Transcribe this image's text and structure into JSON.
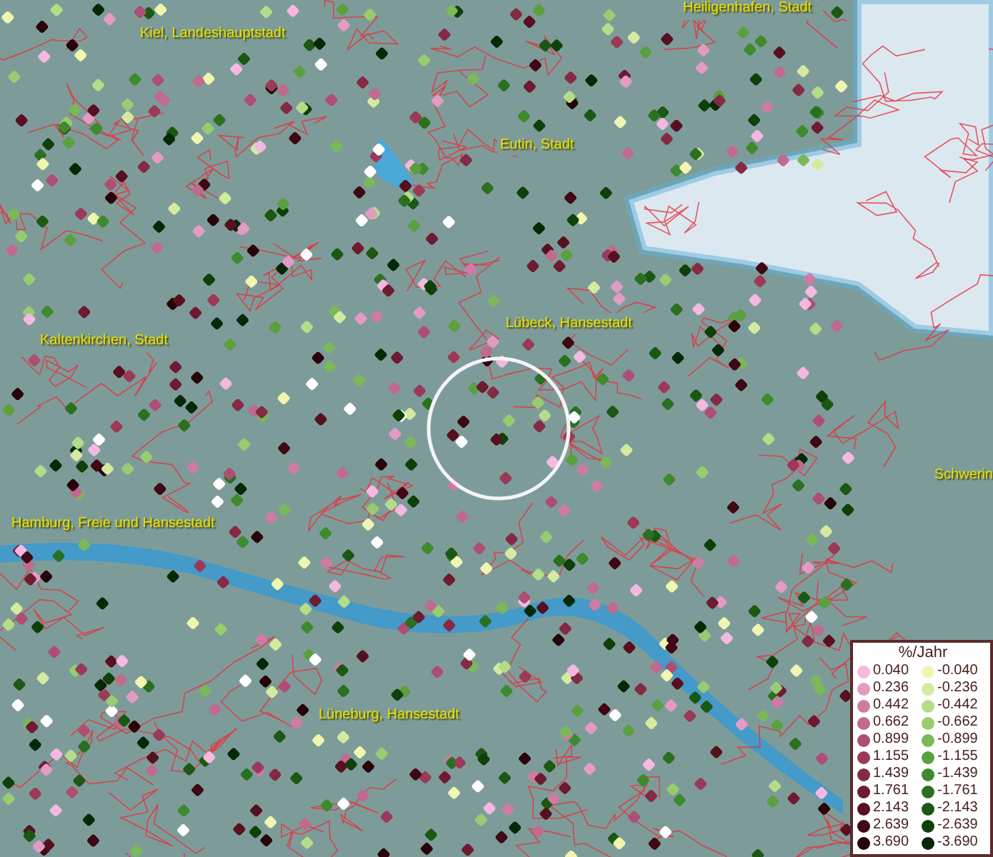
{
  "map": {
    "places": [
      {
        "name": "Heiligenhafen, Stadt"
      },
      {
        "name": "Kiel, Landeshauptstadt"
      },
      {
        "name": "Eutin, Stadt"
      },
      {
        "name": "Lübeck, Hansestadt"
      },
      {
        "name": "Kaltenkirchen, Stadt"
      },
      {
        "name": "Schwerin"
      },
      {
        "name": "Hamburg, Freie und Hansestadt"
      },
      {
        "name": "Lüneburg, Hansestadt"
      }
    ]
  },
  "legend": {
    "title": "%/Jahr",
    "rows": [
      {
        "positive": {
          "label": "0.040",
          "color": "#f5b8e0"
        },
        "negative": {
          "label": "-0.040",
          "color": "#f0f5b0"
        }
      },
      {
        "positive": {
          "label": "0.236",
          "color": "#e39bc4"
        },
        "negative": {
          "label": "-0.236",
          "color": "#d4eaa0"
        }
      },
      {
        "positive": {
          "label": "0.442",
          "color": "#d07ba3"
        },
        "negative": {
          "label": "-0.442",
          "color": "#b5dc88"
        }
      },
      {
        "positive": {
          "label": "0.662",
          "color": "#c06a8e"
        },
        "negative": {
          "label": "-0.662",
          "color": "#98cc70"
        }
      },
      {
        "positive": {
          "label": "0.899",
          "color": "#ad4f72"
        },
        "negative": {
          "label": "-0.899",
          "color": "#7ab85a"
        }
      },
      {
        "positive": {
          "label": "1.155",
          "color": "#9a3a58"
        },
        "negative": {
          "label": "-1.155",
          "color": "#5aa040"
        }
      },
      {
        "positive": {
          "label": "1.439",
          "color": "#852a44"
        },
        "negative": {
          "label": "-1.439",
          "color": "#3e8a2e"
        }
      },
      {
        "positive": {
          "label": "1.761",
          "color": "#6e1a30"
        },
        "negative": {
          "label": "-1.761",
          "color": "#2a7020"
        }
      },
      {
        "positive": {
          "label": "2.143",
          "color": "#561020"
        },
        "negative": {
          "label": "-2.143",
          "color": "#1a5814"
        }
      },
      {
        "positive": {
          "label": "2.639",
          "color": "#3e0814"
        },
        "negative": {
          "label": "-2.639",
          "color": "#0e400a"
        }
      },
      {
        "positive": {
          "label": "3.690",
          "color": "#28040a"
        },
        "negative": {
          "label": "-3.690",
          "color": "#062806"
        }
      }
    ]
  }
}
